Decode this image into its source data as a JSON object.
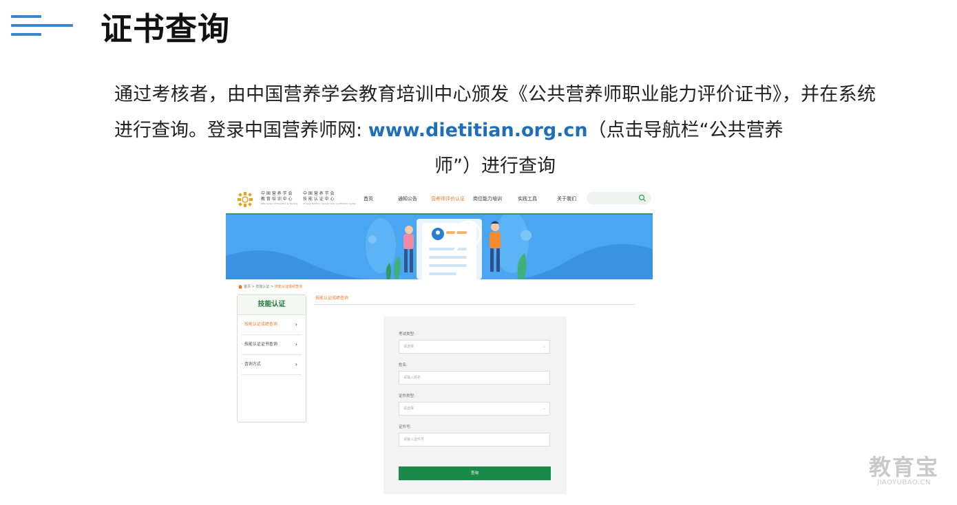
{
  "slide": {
    "title": "证书查询",
    "paragraph": {
      "part1": "通过考核者，由中国营养学会教育培训中心颁发《公共营养师职业能力评价证书》，并在系统进行查询。登录中国营养师网: ",
      "url": "www.dietitian.org.cn",
      "part2": "（点击导航栏“公共营养",
      "part3": "师”）进行查询"
    }
  },
  "site": {
    "logo": {
      "line1": "中 国 营 养 学 会",
      "line2": "教 育 培 训 中 心",
      "sub1": "CNS Center of Education & Training",
      "line3": "中 国 营 养 学 会",
      "line4": "技 能 认 证 中 心",
      "sub2": "Chinese Nutrition Society Skills Certification Center"
    },
    "nav": [
      "首页",
      "通知公告",
      "营养师评价认证",
      "岗位能力培训",
      "实践工具",
      "关于我们"
    ],
    "breadcrumb": {
      "home": "首页",
      "sep": ">",
      "level1": "技能认证",
      "current": "技能认证成绩查询"
    },
    "sidebar": {
      "title": "技能认证",
      "items": [
        "· 技能认证成绩查询",
        "· 技能认证证书查询",
        "· 咨询方式"
      ],
      "chevron": "›"
    },
    "section_title": "技能认证成绩查询",
    "form": {
      "exam_type_label": "考试类型:",
      "exam_type_value": "请选择",
      "name_label": "姓名:",
      "name_placeholder": "请输入姓名",
      "id_type_label": "证件类型:",
      "id_type_value": "请选择",
      "id_no_label": "证件号:",
      "id_no_placeholder": "请输入证件号",
      "submit": "查询"
    }
  },
  "watermark": {
    "cn": "教育宝",
    "en": "JIAOYUBAO.CN"
  },
  "colors": {
    "accent_blue": "#3b86cc",
    "link_blue": "#1f6fb8",
    "site_green": "#1a8a4a",
    "site_orange": "#e8792f",
    "banner_blue": "#4aa6f0"
  }
}
